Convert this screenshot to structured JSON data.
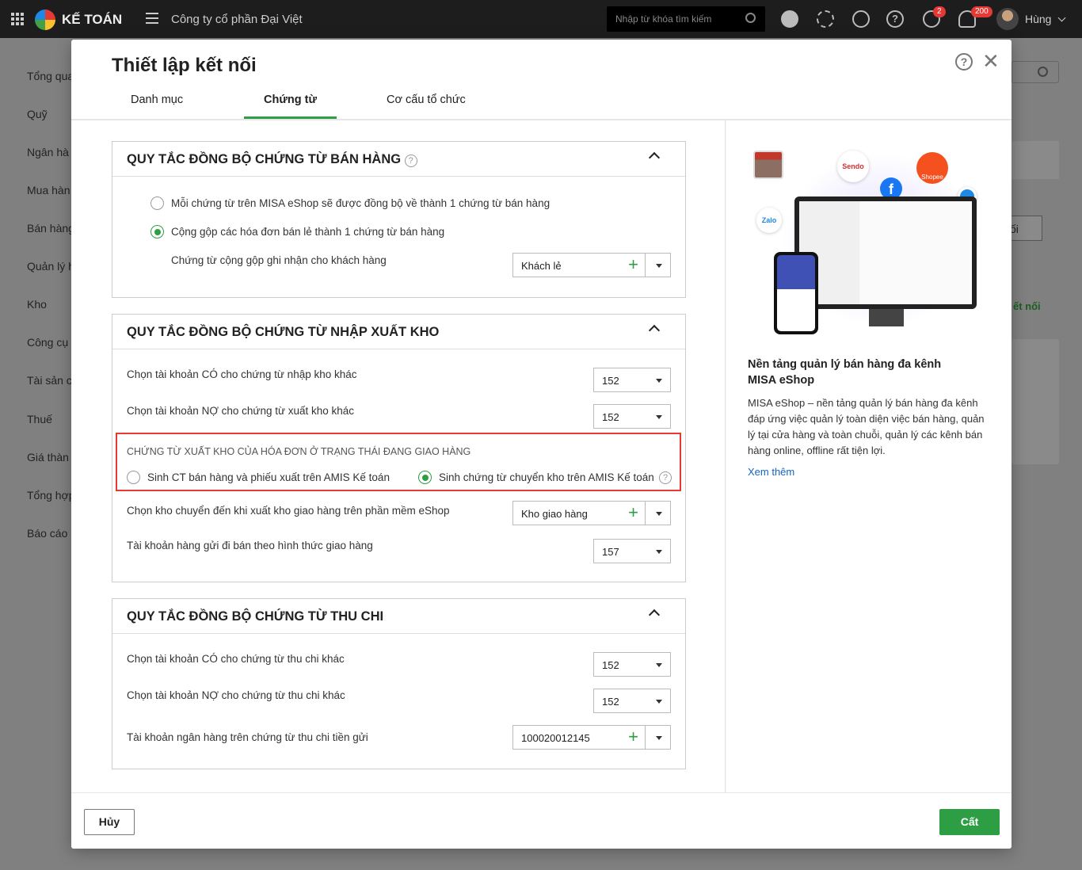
{
  "topbar": {
    "app_name": "KẾ TOÁN",
    "company": "Công ty cổ phần Đại Việt",
    "search_placeholder": "Nhập từ khóa tìm kiếm",
    "badge_sync": "2",
    "badge_notify": "200",
    "user": "Hùng"
  },
  "sidebar": {
    "items": [
      "Tổng qua",
      "Quỹ",
      "Ngân hà",
      "Mua hàn",
      "Bán hàng",
      "Quản lý h",
      "Kho",
      "Công cụ",
      "Tài sản c",
      "Thuế",
      "Giá thàn",
      "Tổng hợp",
      "Báo cáo"
    ]
  },
  "background": {
    "btn_label": "ối",
    "link": "ết nối"
  },
  "modal": {
    "title": "Thiết lập kết nối",
    "tabs": [
      "Danh mục",
      "Chứng từ",
      "Cơ cấu tổ chức"
    ],
    "active_tab": "Chứng từ"
  },
  "sales": {
    "title": "QUY TẮC ĐỒNG BỘ CHỨNG TỪ BÁN HÀNG",
    "opt1": "Mỗi chứng từ trên MISA eShop sẽ được đồng bộ về thành 1 chứng từ bán hàng",
    "opt2": "Cộng gộp các hóa đơn bán lẻ thành 1 chứng từ bán hàng",
    "customer_label": "Chứng từ cộng gộp ghi nhận cho khách  hàng",
    "customer_value": "Khách lẻ"
  },
  "stock": {
    "title": "QUY TẮC ĐỒNG BỘ CHỨNG TỪ NHẬP XUẤT KHO",
    "credit_label": "Chọn tài khoản CÓ cho chứng từ nhập kho khác",
    "credit_value": "152",
    "debit_label": "Chọn tài khoản NỢ cho chứng từ xuất kho khác",
    "debit_value": "152",
    "delivery_heading": "CHỨNG TỪ XUẤT KHO CỦA HÓA ĐƠN Ở TRẠNG THÁI ĐANG GIAO HÀNG",
    "delivery_opt1": "Sinh CT bán hàng và phiếu xuất trên AMIS Kế toán",
    "delivery_opt2": "Sinh chứng từ chuyển kho trên AMIS Kế toán",
    "warehouse_label": "Chọn kho chuyển đến khi xuất kho giao hàng trên phần mềm eShop",
    "warehouse_value": "Kho giao hàng",
    "consign_label": "Tài khoản hàng gửi đi bán theo hình thức giao hàng",
    "consign_value": "157"
  },
  "cash": {
    "title": "QUY TẮC ĐỒNG BỘ CHỨNG TỪ THU CHI",
    "credit_label": "Chọn tài khoản CÓ cho chứng từ thu chi khác",
    "credit_value": "152",
    "debit_label": "Chọn tài khoản NỢ cho chứng từ thu chi khác",
    "debit_value": "152",
    "bank_label": "Tài khoản ngân hàng trên chứng từ thu chi tiền gửi",
    "bank_value": "100020012145"
  },
  "promo": {
    "heading": "Nền tảng quản lý bán hàng đa kênh MISA eShop",
    "body": "MISA eShop – nền tảng quản lý bán hàng đa kênh đáp ứng việc quản lý toàn diện việc bán hàng, quản lý tại cửa hàng và toàn chuỗi, quản lý các kênh bán hàng online, offline  rất tiện lợi.",
    "link": "Xem thêm",
    "logos": [
      "Sendo",
      "Shopee",
      "Zalo"
    ]
  },
  "footer": {
    "cancel": "Hủy",
    "save": "Cất"
  },
  "colors": {
    "accent": "#2e9e44",
    "highlight": "#e53935"
  }
}
